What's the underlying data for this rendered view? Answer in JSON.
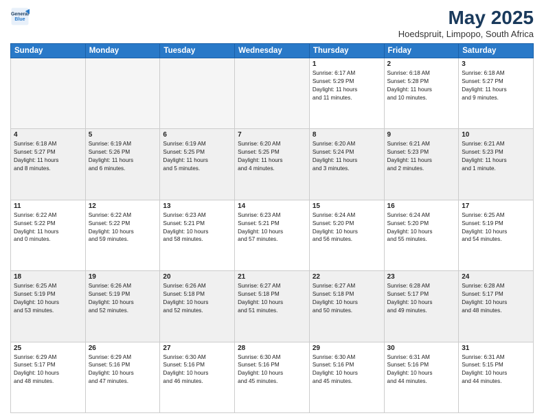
{
  "logo": {
    "line1": "General",
    "line2": "Blue"
  },
  "title": "May 2025",
  "location": "Hoedspruit, Limpopo, South Africa",
  "days_header": [
    "Sunday",
    "Monday",
    "Tuesday",
    "Wednesday",
    "Thursday",
    "Friday",
    "Saturday"
  ],
  "weeks": [
    [
      {
        "day": "",
        "info": ""
      },
      {
        "day": "",
        "info": ""
      },
      {
        "day": "",
        "info": ""
      },
      {
        "day": "",
        "info": ""
      },
      {
        "day": "1",
        "info": "Sunrise: 6:17 AM\nSunset: 5:29 PM\nDaylight: 11 hours\nand 11 minutes."
      },
      {
        "day": "2",
        "info": "Sunrise: 6:18 AM\nSunset: 5:28 PM\nDaylight: 11 hours\nand 10 minutes."
      },
      {
        "day": "3",
        "info": "Sunrise: 6:18 AM\nSunset: 5:27 PM\nDaylight: 11 hours\nand 9 minutes."
      }
    ],
    [
      {
        "day": "4",
        "info": "Sunrise: 6:18 AM\nSunset: 5:27 PM\nDaylight: 11 hours\nand 8 minutes."
      },
      {
        "day": "5",
        "info": "Sunrise: 6:19 AM\nSunset: 5:26 PM\nDaylight: 11 hours\nand 6 minutes."
      },
      {
        "day": "6",
        "info": "Sunrise: 6:19 AM\nSunset: 5:25 PM\nDaylight: 11 hours\nand 5 minutes."
      },
      {
        "day": "7",
        "info": "Sunrise: 6:20 AM\nSunset: 5:25 PM\nDaylight: 11 hours\nand 4 minutes."
      },
      {
        "day": "8",
        "info": "Sunrise: 6:20 AM\nSunset: 5:24 PM\nDaylight: 11 hours\nand 3 minutes."
      },
      {
        "day": "9",
        "info": "Sunrise: 6:21 AM\nSunset: 5:23 PM\nDaylight: 11 hours\nand 2 minutes."
      },
      {
        "day": "10",
        "info": "Sunrise: 6:21 AM\nSunset: 5:23 PM\nDaylight: 11 hours\nand 1 minute."
      }
    ],
    [
      {
        "day": "11",
        "info": "Sunrise: 6:22 AM\nSunset: 5:22 PM\nDaylight: 11 hours\nand 0 minutes."
      },
      {
        "day": "12",
        "info": "Sunrise: 6:22 AM\nSunset: 5:22 PM\nDaylight: 10 hours\nand 59 minutes."
      },
      {
        "day": "13",
        "info": "Sunrise: 6:23 AM\nSunset: 5:21 PM\nDaylight: 10 hours\nand 58 minutes."
      },
      {
        "day": "14",
        "info": "Sunrise: 6:23 AM\nSunset: 5:21 PM\nDaylight: 10 hours\nand 57 minutes."
      },
      {
        "day": "15",
        "info": "Sunrise: 6:24 AM\nSunset: 5:20 PM\nDaylight: 10 hours\nand 56 minutes."
      },
      {
        "day": "16",
        "info": "Sunrise: 6:24 AM\nSunset: 5:20 PM\nDaylight: 10 hours\nand 55 minutes."
      },
      {
        "day": "17",
        "info": "Sunrise: 6:25 AM\nSunset: 5:19 PM\nDaylight: 10 hours\nand 54 minutes."
      }
    ],
    [
      {
        "day": "18",
        "info": "Sunrise: 6:25 AM\nSunset: 5:19 PM\nDaylight: 10 hours\nand 53 minutes."
      },
      {
        "day": "19",
        "info": "Sunrise: 6:26 AM\nSunset: 5:19 PM\nDaylight: 10 hours\nand 52 minutes."
      },
      {
        "day": "20",
        "info": "Sunrise: 6:26 AM\nSunset: 5:18 PM\nDaylight: 10 hours\nand 52 minutes."
      },
      {
        "day": "21",
        "info": "Sunrise: 6:27 AM\nSunset: 5:18 PM\nDaylight: 10 hours\nand 51 minutes."
      },
      {
        "day": "22",
        "info": "Sunrise: 6:27 AM\nSunset: 5:18 PM\nDaylight: 10 hours\nand 50 minutes."
      },
      {
        "day": "23",
        "info": "Sunrise: 6:28 AM\nSunset: 5:17 PM\nDaylight: 10 hours\nand 49 minutes."
      },
      {
        "day": "24",
        "info": "Sunrise: 6:28 AM\nSunset: 5:17 PM\nDaylight: 10 hours\nand 48 minutes."
      }
    ],
    [
      {
        "day": "25",
        "info": "Sunrise: 6:29 AM\nSunset: 5:17 PM\nDaylight: 10 hours\nand 48 minutes."
      },
      {
        "day": "26",
        "info": "Sunrise: 6:29 AM\nSunset: 5:16 PM\nDaylight: 10 hours\nand 47 minutes."
      },
      {
        "day": "27",
        "info": "Sunrise: 6:30 AM\nSunset: 5:16 PM\nDaylight: 10 hours\nand 46 minutes."
      },
      {
        "day": "28",
        "info": "Sunrise: 6:30 AM\nSunset: 5:16 PM\nDaylight: 10 hours\nand 45 minutes."
      },
      {
        "day": "29",
        "info": "Sunrise: 6:30 AM\nSunset: 5:16 PM\nDaylight: 10 hours\nand 45 minutes."
      },
      {
        "day": "30",
        "info": "Sunrise: 6:31 AM\nSunset: 5:16 PM\nDaylight: 10 hours\nand 44 minutes."
      },
      {
        "day": "31",
        "info": "Sunrise: 6:31 AM\nSunset: 5:15 PM\nDaylight: 10 hours\nand 44 minutes."
      }
    ]
  ]
}
